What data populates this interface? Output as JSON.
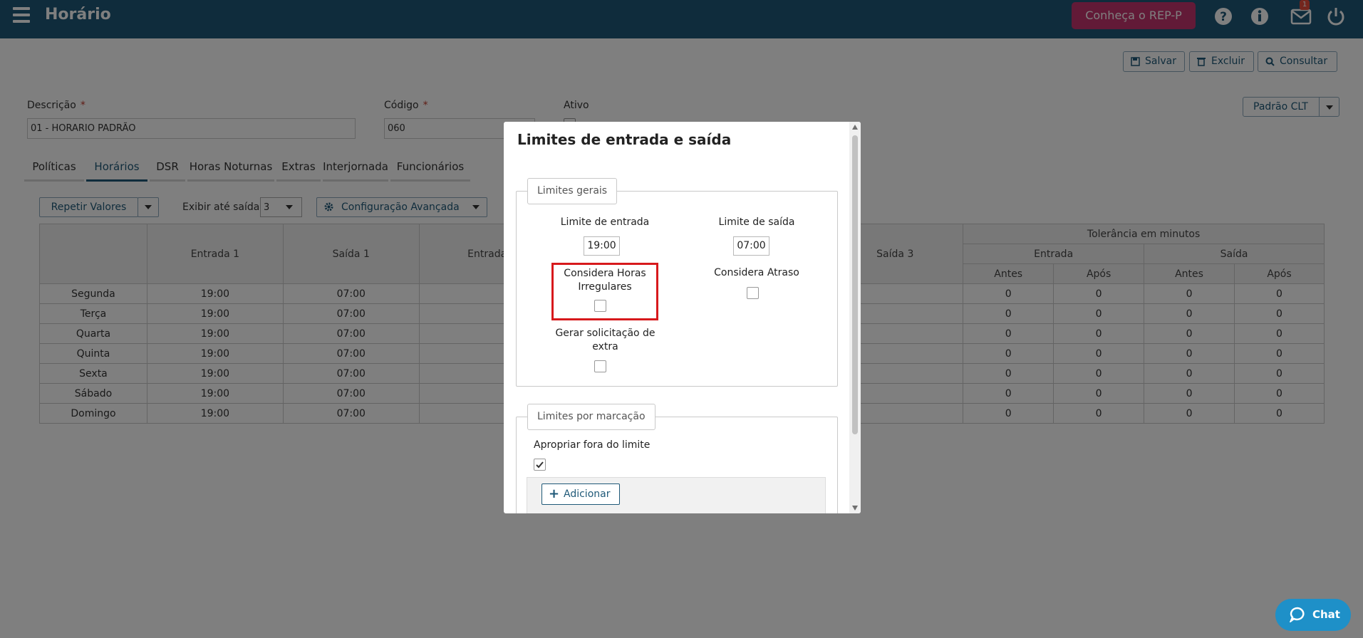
{
  "header": {
    "title": "Horário",
    "rep_button": "Conheça o REP-P",
    "mail_badge": "1",
    "icons": [
      "menu-icon",
      "help-icon",
      "info-icon",
      "mail-icon",
      "power-icon"
    ]
  },
  "toolbar": {
    "save": "Salvar",
    "delete": "Excluir",
    "query": "Consultar"
  },
  "form": {
    "descricao_label": "Descrição",
    "descricao_value": "01 - HORARIO PADRÃO",
    "codigo_label": "Código",
    "codigo_value": "060",
    "ativo_label": "Ativo",
    "required_mark": "*",
    "padrao_select": "Padrão CLT"
  },
  "tabs": [
    "Políticas",
    "Horários",
    "DSR",
    "Horas Noturnas",
    "Extras",
    "Interjornada",
    "Funcionários"
  ],
  "controls": {
    "repeat": "Repetir Valores",
    "show_until_label": "Exibir até saída:",
    "show_until_value": "3",
    "advanced": "Configuração Avançada"
  },
  "table": {
    "headers": {
      "entrada1": "Entrada 1",
      "saida1": "Saída 1",
      "entrada2": "Entrada",
      "saida3": "Saída 3",
      "tolerancia": "Tolerância em minutos",
      "entrada": "Entrada",
      "saida": "Saída",
      "antes": "Antes",
      "apos": "Após"
    },
    "rows": [
      {
        "day": "Segunda",
        "e1": "19:00",
        "s1": "07:00",
        "t": [
          "0",
          "0",
          "0",
          "0"
        ]
      },
      {
        "day": "Terça",
        "e1": "19:00",
        "s1": "07:00",
        "t": [
          "0",
          "0",
          "0",
          "0"
        ]
      },
      {
        "day": "Quarta",
        "e1": "19:00",
        "s1": "07:00",
        "t": [
          "0",
          "0",
          "0",
          "0"
        ]
      },
      {
        "day": "Quinta",
        "e1": "19:00",
        "s1": "07:00",
        "t": [
          "0",
          "0",
          "0",
          "0"
        ]
      },
      {
        "day": "Sexta",
        "e1": "19:00",
        "s1": "07:00",
        "t": [
          "0",
          "0",
          "0",
          "0"
        ]
      },
      {
        "day": "Sábado",
        "e1": "19:00",
        "s1": "07:00",
        "t": [
          "0",
          "0",
          "0",
          "0"
        ]
      },
      {
        "day": "Domingo",
        "e1": "19:00",
        "s1": "07:00",
        "t": [
          "0",
          "0",
          "0",
          "0"
        ]
      }
    ]
  },
  "modal": {
    "title": "Limites de entrada e saída",
    "general_legend": "Limites gerais",
    "entry_limit_label": "Limite de entrada",
    "entry_limit_value": "19:00",
    "exit_limit_label": "Limite de saída",
    "exit_limit_value": "07:00",
    "irregular_label_1": "Considera Horas",
    "irregular_label_2": "Irregulares",
    "delay_label": "Considera Atraso",
    "extra_label_1": "Gerar solicitação de",
    "extra_label_2": "extra",
    "per_mark_legend": "Limites por marcação",
    "appropriate_label": "Apropriar fora do limite",
    "appropriate_checked": true,
    "add_button": "Adicionar"
  },
  "chat": {
    "label": "Chat"
  }
}
